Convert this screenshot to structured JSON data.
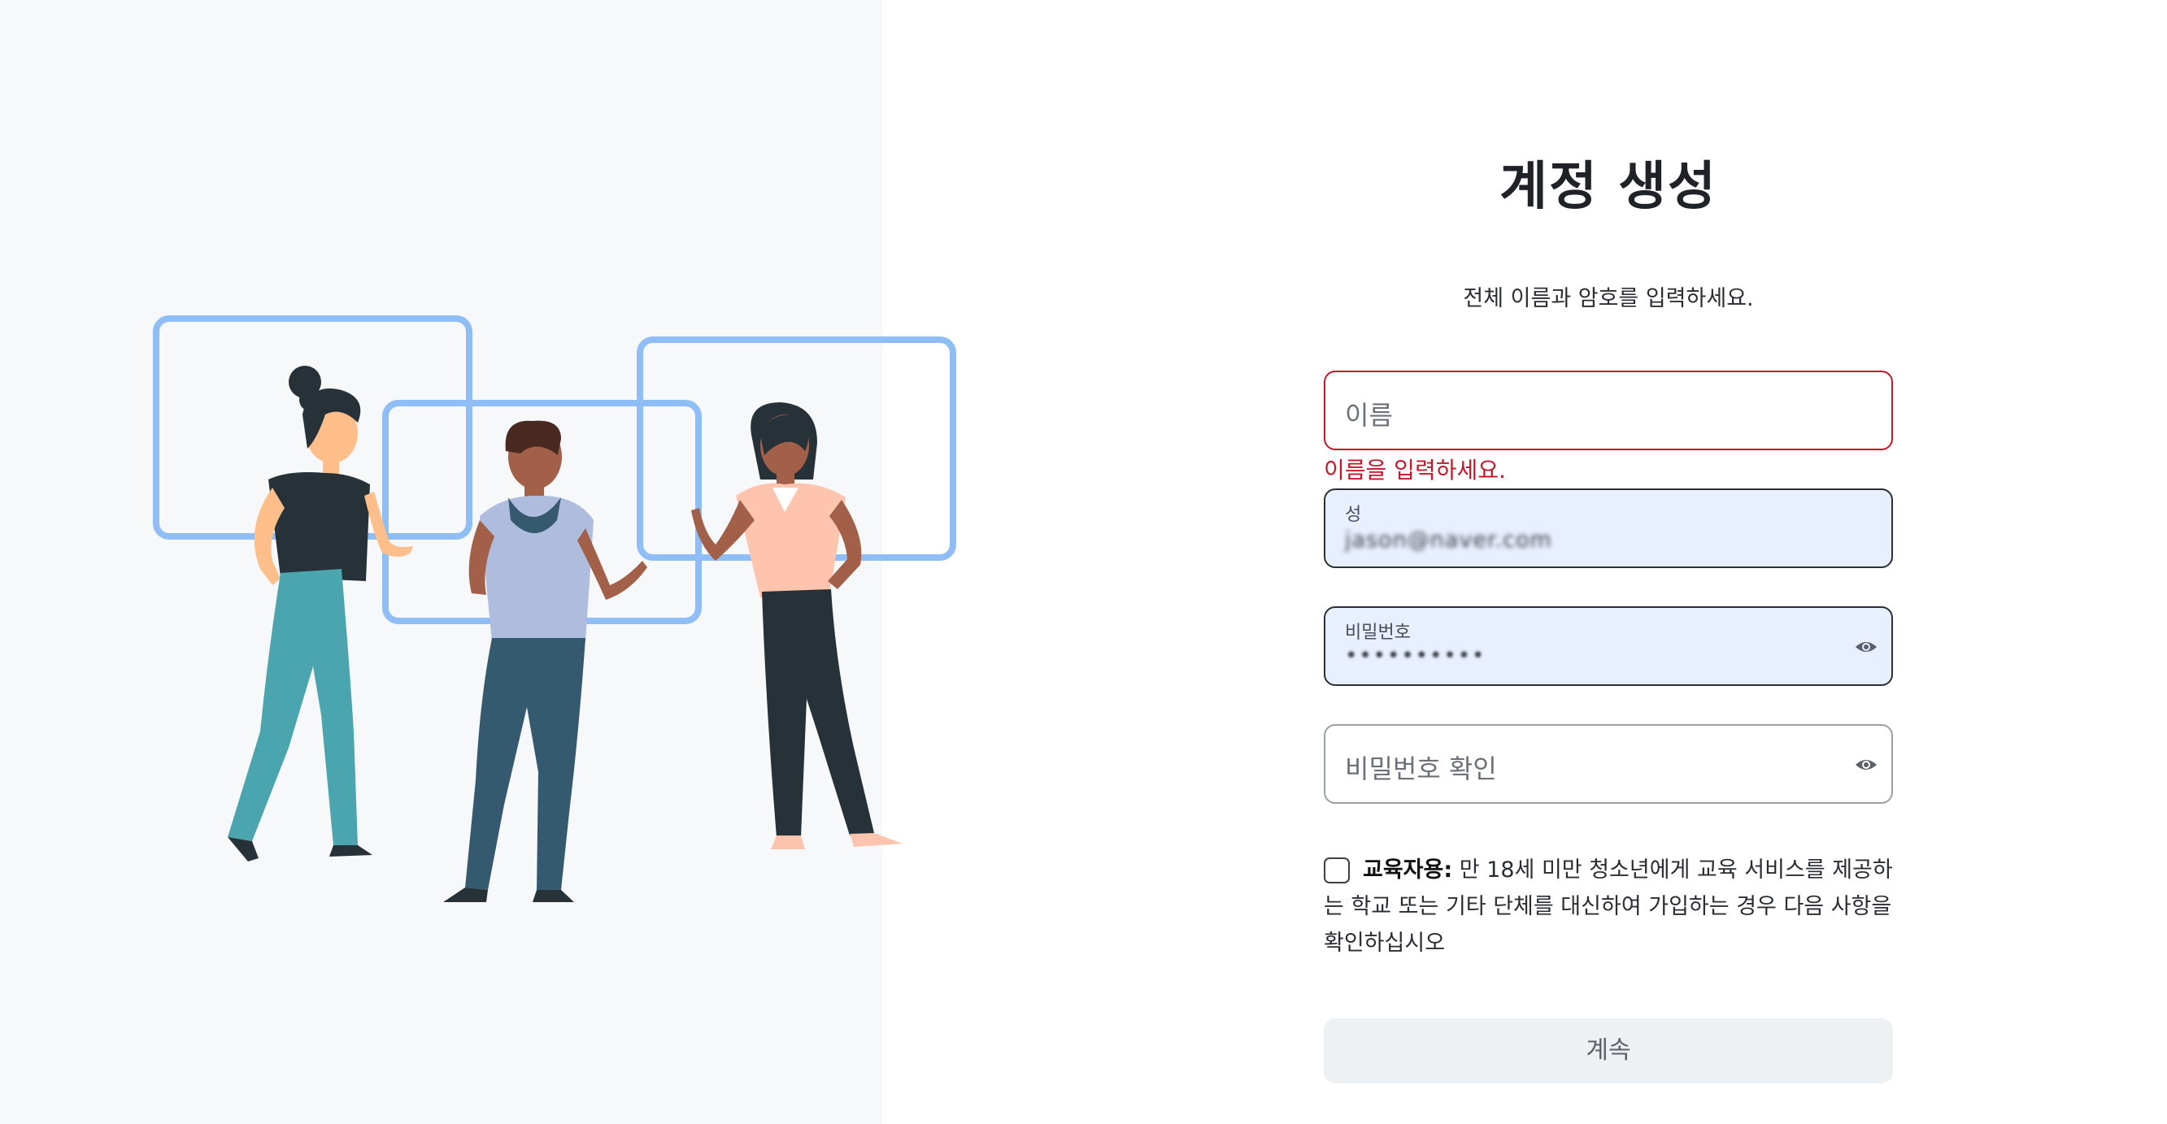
{
  "page": {
    "title": "계정 생성",
    "subtitle": "전체 이름과 암호를 입력하세요."
  },
  "fields": {
    "first_name": {
      "placeholder": "이름",
      "error": "이름을 입력하세요."
    },
    "last_name": {
      "label": "성",
      "value": "jason@naver.com"
    },
    "password": {
      "label": "비밀번호",
      "value": "••••••••••"
    },
    "password_confirm": {
      "placeholder": "비밀번호 확인"
    }
  },
  "education": {
    "checked": false,
    "label_bold": "교육자용:",
    "label_text": " 만 18세 미만 청소년에게 교육 서비스를 제공하는 학교 또는 기타 단체를 대신하여 가입하는 경우 다음 사항을 확인하십시오"
  },
  "continue_button": {
    "label": "계속",
    "enabled": false
  },
  "icons": {
    "password_toggle": "eye-icon",
    "password_confirm_toggle": "eye-icon"
  },
  "colors": {
    "error": "#c2182b",
    "autofill_bg": "#e8effe",
    "frame_blue": "#8fbdf5",
    "left_panel_bg": "#f7f8fa",
    "button_bg": "#eef1f4"
  }
}
